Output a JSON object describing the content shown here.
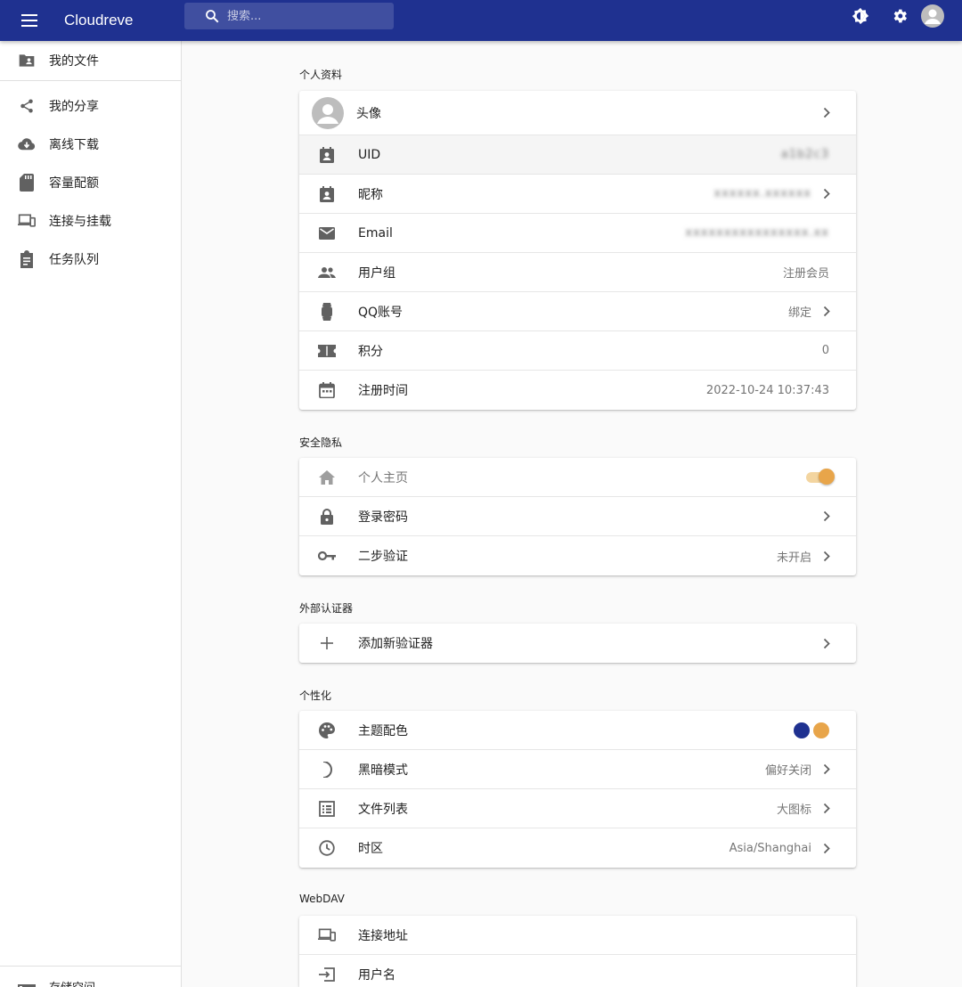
{
  "appbar": {
    "title": "Cloudreve",
    "search_placeholder": "搜索..."
  },
  "sidebar": {
    "items": [
      {
        "label": "我的文件"
      },
      {
        "label": "我的分享"
      },
      {
        "label": "离线下载"
      },
      {
        "label": "容量配额"
      },
      {
        "label": "连接与挂载"
      },
      {
        "label": "任务队列"
      }
    ],
    "storage_label": "存储空间"
  },
  "profile": {
    "title": "个人资料",
    "avatar_label": "头像",
    "uid_label": "UID",
    "uid_value": "a1b2c3",
    "nickname_label": "昵称",
    "nickname_value": "xxxxxx.xxxxxx",
    "email_label": "Email",
    "email_value": "xxxxxxxxxxxxxxxx.xx",
    "group_label": "用户组",
    "group_value": "注册会员",
    "qq_label": "QQ账号",
    "qq_value": "绑定",
    "score_label": "积分",
    "score_value": "0",
    "reg_label": "注册时间",
    "reg_value": "2022-10-24 10:37:43"
  },
  "security": {
    "title": "安全隐私",
    "homepage_label": "个人主页",
    "homepage_enabled": true,
    "password_label": "登录密码",
    "twofa_label": "二步验证",
    "twofa_value": "未开启"
  },
  "authenticator": {
    "title": "外部认证器",
    "add_label": "添加新验证器"
  },
  "personalize": {
    "title": "个性化",
    "theme_label": "主题配色",
    "theme_colors": {
      "primary": "#1f3190",
      "secondary": "#e8a54a"
    },
    "dark_label": "黑暗模式",
    "dark_value": "偏好关闭",
    "filelist_label": "文件列表",
    "filelist_value": "大图标",
    "timezone_label": "时区",
    "timezone_value": "Asia/Shanghai"
  },
  "webdav": {
    "title": "WebDAV",
    "address_label": "连接地址",
    "username_label": "用户名"
  }
}
